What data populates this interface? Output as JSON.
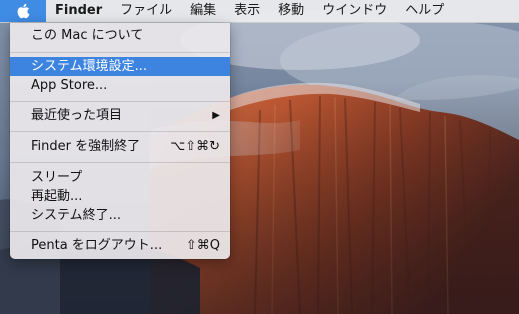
{
  "menubar": {
    "apple_icon": "apple-logo-icon",
    "app_name": "Finder",
    "items": [
      "ファイル",
      "編集",
      "表示",
      "移動",
      "ウインドウ",
      "ヘルプ"
    ]
  },
  "apple_menu": {
    "about": "この Mac について",
    "system_prefs": "システム環境設定...",
    "app_store": "App Store...",
    "recent_items": "最近使った項目",
    "recent_arrow": "▶",
    "force_quit": "Finder を強制終了",
    "force_quit_shortcut": "⌥⇧⌘↻",
    "sleep": "スリープ",
    "restart": "再起動...",
    "shutdown": "システム終了...",
    "logout": "Penta をログアウト...",
    "logout_shortcut": "⇧⌘Q"
  },
  "colors": {
    "highlight": "#3d84e0",
    "menubar_bg": "#ececee"
  }
}
